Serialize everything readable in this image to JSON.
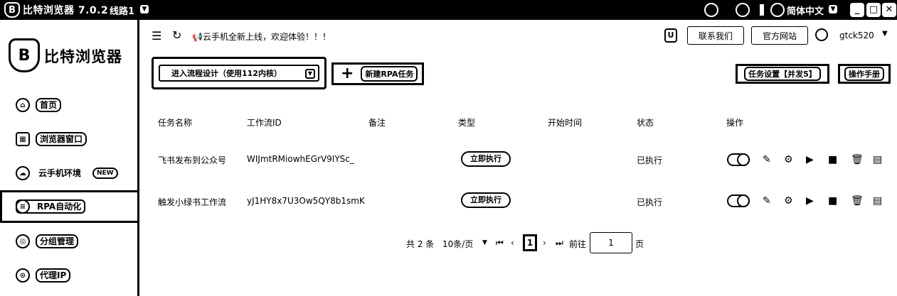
{
  "titlebar": {
    "app_title": "比特浏览器 7.0.2",
    "line_label": "线路1",
    "language": "简体中文"
  },
  "sidebar": {
    "brand": "比特浏览器",
    "items": [
      {
        "label": "首页",
        "icon": "home-icon"
      },
      {
        "label": "浏览器窗口",
        "icon": "window-icon"
      },
      {
        "label": "云手机环境",
        "icon": "cloud-phone-icon",
        "badge": "NEW"
      },
      {
        "label": "RPA自动化",
        "icon": "rpa-icon",
        "active": true
      },
      {
        "label": "分组管理",
        "icon": "group-icon"
      },
      {
        "label": "代理IP",
        "icon": "location-icon"
      }
    ]
  },
  "header": {
    "announcement": "云手机全新上线，欢迎体验！！！",
    "contact_label": "联系我们",
    "website_label": "官方网站",
    "username": "gtck520"
  },
  "toolbar": {
    "flow_design_label": "进入流程设计（使用112内核）",
    "new_rpa_label": "新建RPA任务",
    "task_settings_label": "任务设置【并发5】",
    "manual_label": "操作手册"
  },
  "table": {
    "headers": [
      "任务名称",
      "工作流ID",
      "备注",
      "类型",
      "开始时间",
      "状态",
      "操作"
    ],
    "rows": [
      {
        "name": "飞书发布到公众号",
        "workflow_id": "WIJmtRMiowhEGrV9IYSc_",
        "note": "",
        "type": "立即执行",
        "start_time": "",
        "status": "已执行"
      },
      {
        "name": "触发小绿书工作流",
        "workflow_id": "yJ1HY8x7U3Ow5QY8b1smK",
        "note": "",
        "type": "立即执行",
        "start_time": "",
        "status": "已执行"
      }
    ]
  },
  "pagination": {
    "total": "共 2 条",
    "page_size": "10条/页",
    "current_page": "1",
    "goto_label": "前往",
    "goto_value": "1",
    "page_suffix": "页"
  }
}
